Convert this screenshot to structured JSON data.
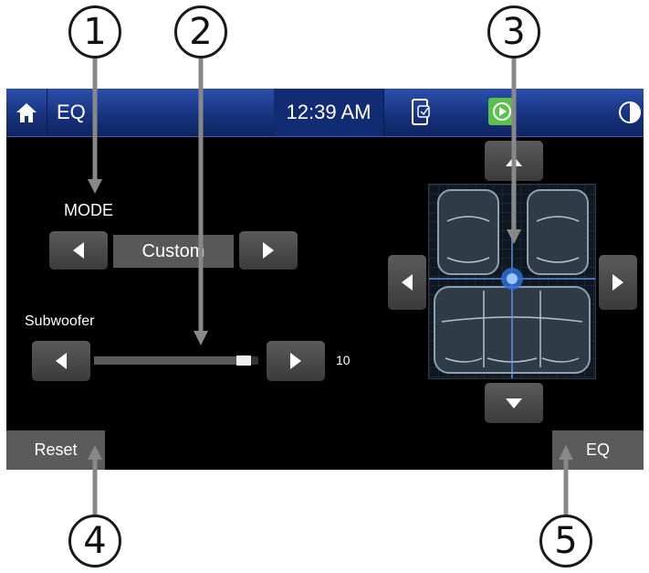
{
  "callouts": [
    "1",
    "2",
    "3",
    "4",
    "5"
  ],
  "topbar": {
    "title": "EQ",
    "time": "12:39 AM",
    "icons": [
      "home-icon",
      "phone-link-icon",
      "media-play-icon",
      "brightness-icon"
    ],
    "accent": "#1f3f95"
  },
  "mode": {
    "label": "MODE",
    "value": "Custom"
  },
  "subwoofer": {
    "label": "Subwoofer",
    "value": "10",
    "level_fraction": 0.95
  },
  "buttons": {
    "reset": "Reset",
    "eq": "EQ"
  },
  "balance": {
    "label": ""
  }
}
